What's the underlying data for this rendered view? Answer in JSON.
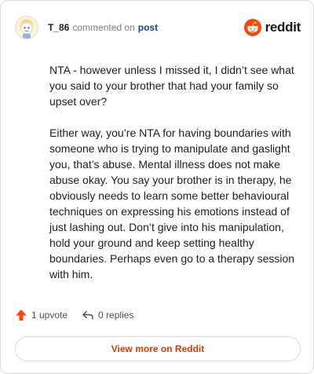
{
  "header": {
    "username": "T_86",
    "commented_text": "commented on",
    "post_link": "post",
    "brand": "reddit"
  },
  "comment": {
    "paragraphs": [
      "NTA - however unless I missed it, I didn’t see what you said to your brother that had your family so upset over?",
      "Either way, you’re NTA for having boundaries with someone who is trying to manipulate and gaslight you, that’s abuse. Mental illness does not make abuse okay. You say your brother is in therapy, he obviously needs to learn some better behavioural techniques on expressing his emotions instead of just lashing out. Don’t give into his manipulation, hold your ground and keep setting healthy boundaries. Perhaps even go to a therapy session with him."
    ]
  },
  "actions": {
    "upvote_label": "1 upvote",
    "replies_label": "0 replies"
  },
  "footer": {
    "view_more_label": "View more on Reddit"
  },
  "colors": {
    "brand_orange": "#ff4500",
    "link_blue": "#0a449b",
    "view_more_text": "#d93a00"
  },
  "icons": {
    "avatar": "snoo-avatar-icon",
    "logo": "reddit-logo-icon",
    "upvote": "upvote-arrow-icon",
    "reply": "reply-arrow-icon"
  }
}
